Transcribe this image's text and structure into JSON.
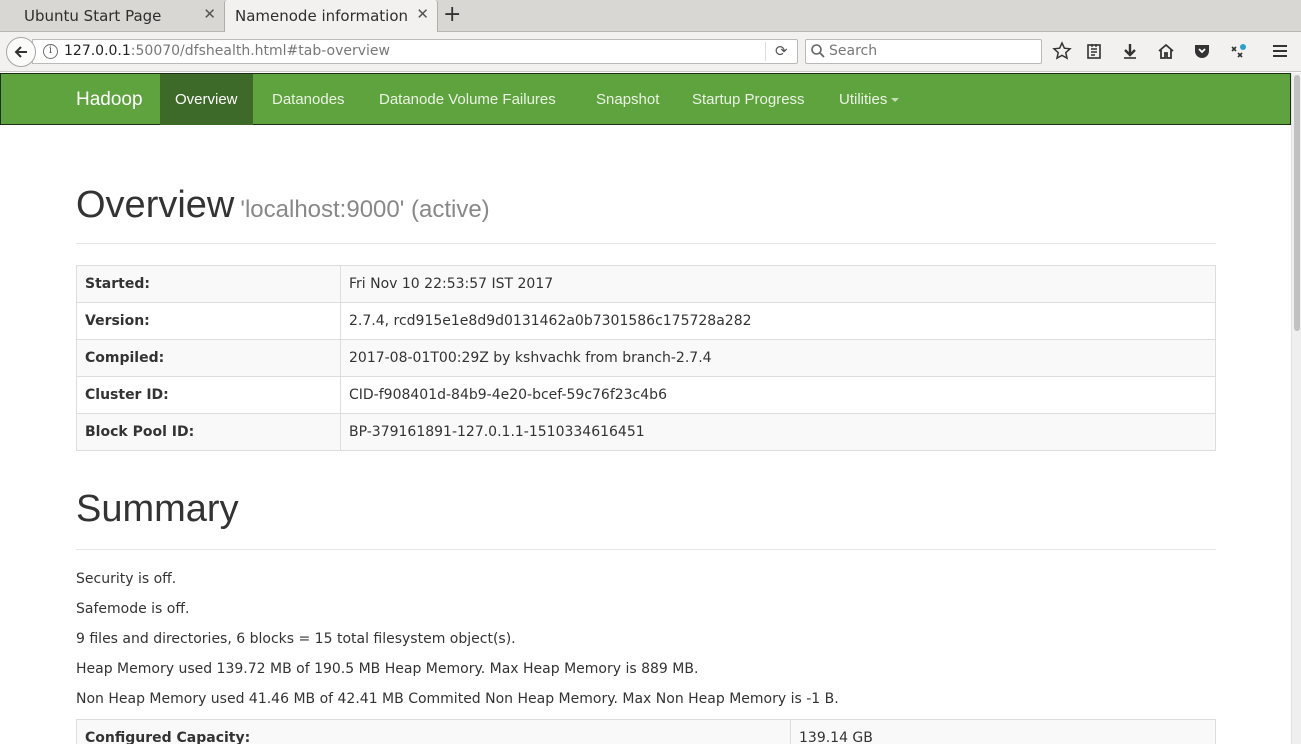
{
  "browser": {
    "tabs": [
      {
        "title": "Ubuntu Start Page",
        "active": false
      },
      {
        "title": "Namenode information",
        "active": true
      }
    ],
    "url": {
      "host": "127.0.0.1",
      "rest": ":50070/dfshealth.html#tab-overview"
    },
    "search_placeholder": "Search"
  },
  "nav": {
    "brand": "Hadoop",
    "items": [
      {
        "label": "Overview",
        "active": true
      },
      {
        "label": "Datanodes"
      },
      {
        "label": "Datanode Volume Failures"
      },
      {
        "label": "Snapshot"
      },
      {
        "label": "Startup Progress"
      },
      {
        "label": "Utilities"
      }
    ]
  },
  "overview": {
    "title": "Overview",
    "subtitle": "'localhost:9000' (active)",
    "rows": [
      {
        "key": "Started:",
        "value": "Fri Nov 10 22:53:57 IST 2017"
      },
      {
        "key": "Version:",
        "value": "2.7.4, rcd915e1e8d9d0131462a0b7301586c175728a282"
      },
      {
        "key": "Compiled:",
        "value": "2017-08-01T00:29Z by kshvachk from branch-2.7.4"
      },
      {
        "key": "Cluster ID:",
        "value": "CID-f908401d-84b9-4e20-bcef-59c76f23c4b6"
      },
      {
        "key": "Block Pool ID:",
        "value": "BP-379161891-127.0.1.1-1510334616451"
      }
    ]
  },
  "summary": {
    "title": "Summary",
    "lines": [
      "Security is off.",
      "Safemode is off.",
      "9 files and directories, 6 blocks = 15 total filesystem object(s).",
      "Heap Memory used 139.72 MB of 190.5 MB Heap Memory. Max Heap Memory is 889 MB.",
      "Non Heap Memory used 41.46 MB of 42.41 MB Commited Non Heap Memory. Max Non Heap Memory is -1 B."
    ],
    "rows": [
      {
        "key": "Configured Capacity:",
        "value": "139.14 GB"
      }
    ]
  },
  "colors": {
    "navbar": "#5fa33e",
    "navbar_active": "#3d6a28"
  }
}
